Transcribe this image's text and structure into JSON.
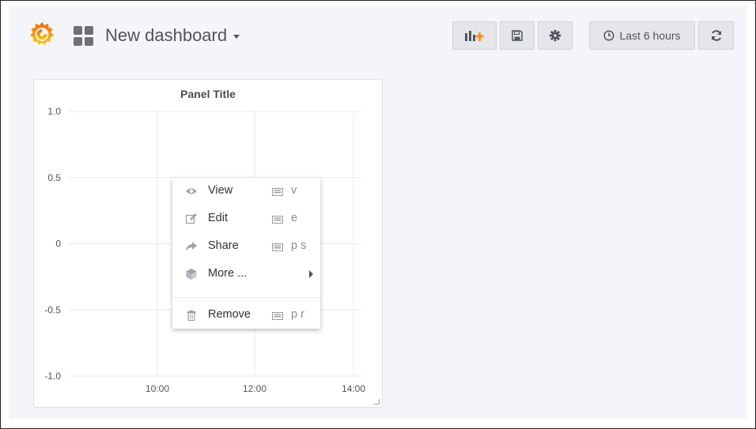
{
  "navbar": {
    "dashboard_title": "New dashboard",
    "time_range_label": "Last 6 hours",
    "buttons": {
      "add_panel_icon": "add-panel-icon",
      "save_icon": "save-icon",
      "settings_icon": "gear-icon",
      "time_icon": "clock-icon",
      "refresh_icon": "refresh-icon"
    }
  },
  "panel": {
    "title": "Panel Title"
  },
  "context_menu": {
    "items": [
      {
        "label": "View",
        "icon": "eye-icon",
        "shortcut": "v"
      },
      {
        "label": "Edit",
        "icon": "edit-icon",
        "shortcut": "e"
      },
      {
        "label": "Share",
        "icon": "share-icon",
        "shortcut": "p s"
      },
      {
        "label": "More ...",
        "icon": "cube-icon",
        "submenu": true
      },
      {
        "label": "Remove",
        "icon": "trash-icon",
        "shortcut": "p r"
      }
    ]
  },
  "colors": {
    "background": "#f4f5f8",
    "panel_bg": "#ffffff",
    "logo_orange": "#f46800",
    "logo_yellow": "#fbca0a",
    "add_panel_accent": "#f7941e"
  },
  "chart_data": {
    "type": "line",
    "title": "Panel Title",
    "x_ticks": [
      "10:00",
      "12:00",
      "14:00"
    ],
    "y_ticks": [
      "1.0",
      "0.5",
      "0",
      "-0.5",
      "-1.0"
    ],
    "y_tick_values": [
      1,
      0.5,
      0,
      -0.5,
      -1
    ],
    "ylim": [
      -1,
      1
    ],
    "series": [],
    "grid": true,
    "legend": "none"
  }
}
